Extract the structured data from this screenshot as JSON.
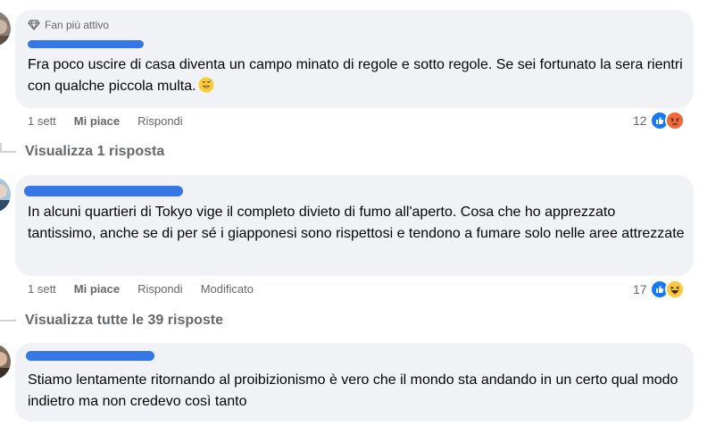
{
  "comments": [
    {
      "badge": "Fan più attivo",
      "text": "Fra poco uscire di casa diventa un campo minato di regole e sotto regole. Se sei fortunato la sera rientri con qualche piccola multa.",
      "time": "1 sett",
      "like_label": "Mi piace",
      "reply_label": "Rispondi",
      "reaction_count": "12",
      "reactions": [
        "like-icon",
        "angry-icon"
      ],
      "view_replies": "Visualizza 1 risposta"
    },
    {
      "text": "In alcuni quartieri di Tokyo vige il completo divieto di fumo all'aperto. Cosa che ho apprezzato tantissimo, anche se di per sé i giapponesi sono rispettosi e tendono a fumare solo nelle aree attrezzate",
      "time": "1 sett",
      "like_label": "Mi piace",
      "reply_label": "Rispondi",
      "edited_label": "Modificato",
      "reaction_count": "17",
      "reactions": [
        "like-icon",
        "haha-icon"
      ],
      "view_replies": "Visualizza tutte le 39 risposte"
    },
    {
      "text": "Stiamo lentamente ritornando al proibizionismo è vero che il mondo sta andando in un certo qual modo indietro ma non credevo così tanto"
    }
  ],
  "colors": {
    "bubble": "#f0f2f5",
    "secondary_text": "#65676b",
    "like_blue": "#1877f2",
    "redaction": "#3578e5"
  }
}
